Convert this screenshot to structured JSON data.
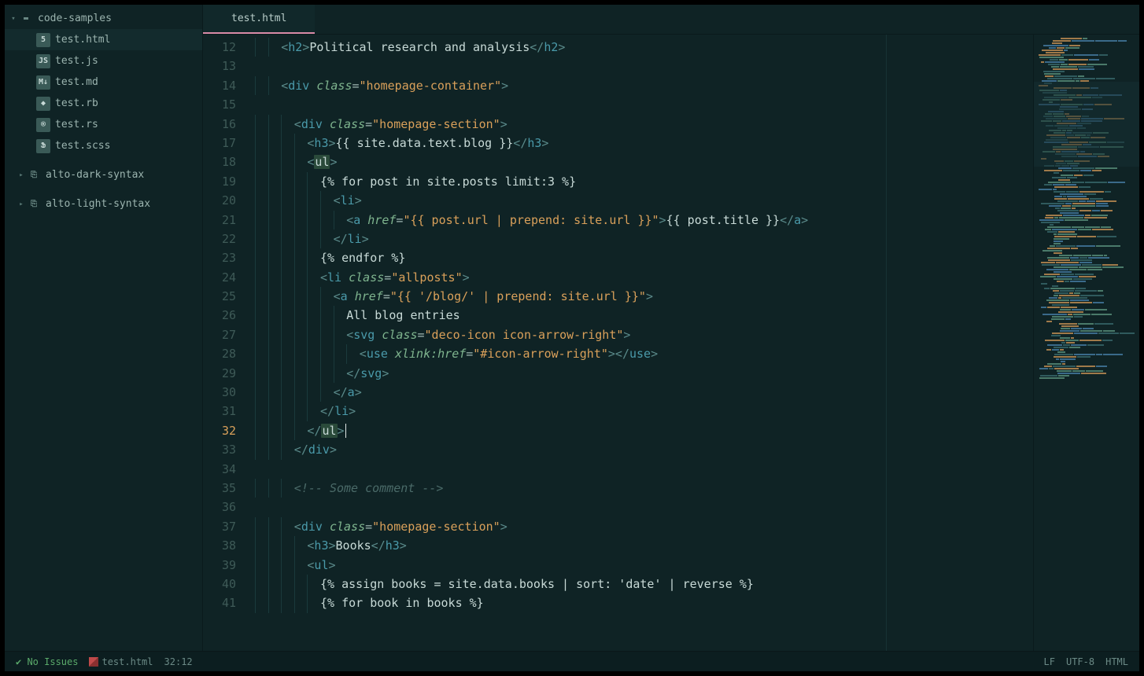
{
  "sidebar": {
    "root_folder": "code-samples",
    "files": [
      {
        "name": "test.html",
        "icon": "html",
        "selected": true,
        "icon_label": "5"
      },
      {
        "name": "test.js",
        "icon": "js",
        "icon_label": "JS"
      },
      {
        "name": "test.md",
        "icon": "md",
        "icon_label": "M↓"
      },
      {
        "name": "test.rb",
        "icon": "rb",
        "icon_label": "◆"
      },
      {
        "name": "test.rs",
        "icon": "rs",
        "icon_label": "®"
      },
      {
        "name": "test.scss",
        "icon": "scss",
        "icon_label": "Ֆ"
      }
    ],
    "projects": [
      {
        "name": "alto-dark-syntax"
      },
      {
        "name": "alto-light-syntax"
      }
    ]
  },
  "tabs": {
    "active": "test.html"
  },
  "editor": {
    "first_line_number": 12,
    "cursor_line": 32,
    "lines": [
      {
        "n": 12,
        "indent": 2,
        "tokens": [
          {
            "c": "p",
            "t": "<"
          },
          {
            "c": "tg",
            "t": "h2"
          },
          {
            "c": "p",
            "t": ">"
          },
          {
            "c": "tx",
            "t": "Political research and analysis"
          },
          {
            "c": "p",
            "t": "</"
          },
          {
            "c": "tg",
            "t": "h2"
          },
          {
            "c": "p",
            "t": ">"
          }
        ]
      },
      {
        "n": 13,
        "indent": 0,
        "tokens": []
      },
      {
        "n": 14,
        "indent": 2,
        "tokens": [
          {
            "c": "p",
            "t": "<"
          },
          {
            "c": "tg",
            "t": "div"
          },
          {
            "c": "tx",
            "t": " "
          },
          {
            "c": "an",
            "t": "class"
          },
          {
            "c": "op",
            "t": "="
          },
          {
            "c": "st",
            "t": "\"homepage-container\""
          },
          {
            "c": "p",
            "t": ">"
          }
        ]
      },
      {
        "n": 15,
        "indent": 0,
        "tokens": []
      },
      {
        "n": 16,
        "indent": 3,
        "tokens": [
          {
            "c": "p",
            "t": "<"
          },
          {
            "c": "tg",
            "t": "div"
          },
          {
            "c": "tx",
            "t": " "
          },
          {
            "c": "an",
            "t": "class"
          },
          {
            "c": "op",
            "t": "="
          },
          {
            "c": "st",
            "t": "\"homepage-section\""
          },
          {
            "c": "p",
            "t": ">"
          }
        ]
      },
      {
        "n": 17,
        "indent": 4,
        "tokens": [
          {
            "c": "p",
            "t": "<"
          },
          {
            "c": "tg",
            "t": "h3"
          },
          {
            "c": "p",
            "t": ">"
          },
          {
            "c": "tx",
            "t": "{{ site.data.text.blog }}"
          },
          {
            "c": "p",
            "t": "</"
          },
          {
            "c": "tg",
            "t": "h3"
          },
          {
            "c": "p",
            "t": ">"
          }
        ]
      },
      {
        "n": 18,
        "indent": 4,
        "tokens": [
          {
            "c": "p",
            "t": "<"
          },
          {
            "c": "hl",
            "t": "ul"
          },
          {
            "c": "p",
            "t": ">"
          }
        ]
      },
      {
        "n": 19,
        "indent": 5,
        "tokens": [
          {
            "c": "tx",
            "t": "{% for post in site.posts limit:3 %}"
          }
        ]
      },
      {
        "n": 20,
        "indent": 6,
        "tokens": [
          {
            "c": "p",
            "t": "<"
          },
          {
            "c": "tg",
            "t": "li"
          },
          {
            "c": "p",
            "t": ">"
          }
        ]
      },
      {
        "n": 21,
        "indent": 7,
        "tokens": [
          {
            "c": "p",
            "t": "<"
          },
          {
            "c": "tg",
            "t": "a"
          },
          {
            "c": "tx",
            "t": " "
          },
          {
            "c": "an",
            "t": "href"
          },
          {
            "c": "op",
            "t": "="
          },
          {
            "c": "st",
            "t": "\"{{ post.url | prepend: site.url }}\""
          },
          {
            "c": "p",
            "t": ">"
          },
          {
            "c": "tx",
            "t": "{{ post.title }}"
          },
          {
            "c": "p",
            "t": "</"
          },
          {
            "c": "tg",
            "t": "a"
          },
          {
            "c": "p",
            "t": ">"
          }
        ]
      },
      {
        "n": 22,
        "indent": 6,
        "tokens": [
          {
            "c": "p",
            "t": "</"
          },
          {
            "c": "tg",
            "t": "li"
          },
          {
            "c": "p",
            "t": ">"
          }
        ]
      },
      {
        "n": 23,
        "indent": 5,
        "tokens": [
          {
            "c": "tx",
            "t": "{% endfor %}"
          }
        ]
      },
      {
        "n": 24,
        "indent": 5,
        "tokens": [
          {
            "c": "p",
            "t": "<"
          },
          {
            "c": "tg",
            "t": "li"
          },
          {
            "c": "tx",
            "t": " "
          },
          {
            "c": "an",
            "t": "class"
          },
          {
            "c": "op",
            "t": "="
          },
          {
            "c": "st",
            "t": "\"allposts\""
          },
          {
            "c": "p",
            "t": ">"
          }
        ]
      },
      {
        "n": 25,
        "indent": 6,
        "tokens": [
          {
            "c": "p",
            "t": "<"
          },
          {
            "c": "tg",
            "t": "a"
          },
          {
            "c": "tx",
            "t": " "
          },
          {
            "c": "an",
            "t": "href"
          },
          {
            "c": "op",
            "t": "="
          },
          {
            "c": "st",
            "t": "\"{{ '/blog/' | prepend: site.url }}\""
          },
          {
            "c": "p",
            "t": ">"
          }
        ]
      },
      {
        "n": 26,
        "indent": 7,
        "tokens": [
          {
            "c": "tx",
            "t": "All blog entries"
          }
        ]
      },
      {
        "n": 27,
        "indent": 7,
        "tokens": [
          {
            "c": "p",
            "t": "<"
          },
          {
            "c": "tg",
            "t": "svg"
          },
          {
            "c": "tx",
            "t": " "
          },
          {
            "c": "an",
            "t": "class"
          },
          {
            "c": "op",
            "t": "="
          },
          {
            "c": "st",
            "t": "\"deco-icon icon-arrow-right\""
          },
          {
            "c": "p",
            "t": ">"
          }
        ]
      },
      {
        "n": 28,
        "indent": 8,
        "tokens": [
          {
            "c": "p",
            "t": "<"
          },
          {
            "c": "tg",
            "t": "use"
          },
          {
            "c": "tx",
            "t": " "
          },
          {
            "c": "an",
            "t": "xlink:href"
          },
          {
            "c": "op",
            "t": "="
          },
          {
            "c": "st",
            "t": "\"#icon-arrow-right\""
          },
          {
            "c": "p",
            "t": ">"
          },
          {
            "c": "p",
            "t": "</"
          },
          {
            "c": "tg",
            "t": "use"
          },
          {
            "c": "p",
            "t": ">"
          }
        ]
      },
      {
        "n": 29,
        "indent": 7,
        "tokens": [
          {
            "c": "p",
            "t": "</"
          },
          {
            "c": "tg",
            "t": "svg"
          },
          {
            "c": "p",
            "t": ">"
          }
        ]
      },
      {
        "n": 30,
        "indent": 6,
        "tokens": [
          {
            "c": "p",
            "t": "</"
          },
          {
            "c": "tg",
            "t": "a"
          },
          {
            "c": "p",
            "t": ">"
          }
        ]
      },
      {
        "n": 31,
        "indent": 5,
        "tokens": [
          {
            "c": "p",
            "t": "</"
          },
          {
            "c": "tg",
            "t": "li"
          },
          {
            "c": "p",
            "t": ">"
          }
        ]
      },
      {
        "n": 32,
        "indent": 4,
        "tokens": [
          {
            "c": "p",
            "t": "</"
          },
          {
            "c": "hl",
            "t": "ul"
          },
          {
            "c": "p",
            "t": ">"
          }
        ],
        "cursor": true
      },
      {
        "n": 33,
        "indent": 3,
        "tokens": [
          {
            "c": "p",
            "t": "</"
          },
          {
            "c": "tg",
            "t": "div"
          },
          {
            "c": "p",
            "t": ">"
          }
        ]
      },
      {
        "n": 34,
        "indent": 0,
        "tokens": []
      },
      {
        "n": 35,
        "indent": 3,
        "tokens": [
          {
            "c": "cm",
            "t": "<!-- Some comment -->"
          }
        ]
      },
      {
        "n": 36,
        "indent": 0,
        "tokens": []
      },
      {
        "n": 37,
        "indent": 3,
        "tokens": [
          {
            "c": "p",
            "t": "<"
          },
          {
            "c": "tg",
            "t": "div"
          },
          {
            "c": "tx",
            "t": " "
          },
          {
            "c": "an",
            "t": "class"
          },
          {
            "c": "op",
            "t": "="
          },
          {
            "c": "st",
            "t": "\"homepage-section\""
          },
          {
            "c": "p",
            "t": ">"
          }
        ]
      },
      {
        "n": 38,
        "indent": 4,
        "tokens": [
          {
            "c": "p",
            "t": "<"
          },
          {
            "c": "tg",
            "t": "h3"
          },
          {
            "c": "p",
            "t": ">"
          },
          {
            "c": "tx",
            "t": "Books"
          },
          {
            "c": "p",
            "t": "</"
          },
          {
            "c": "tg",
            "t": "h3"
          },
          {
            "c": "p",
            "t": ">"
          }
        ]
      },
      {
        "n": 39,
        "indent": 4,
        "tokens": [
          {
            "c": "p",
            "t": "<"
          },
          {
            "c": "tg",
            "t": "ul"
          },
          {
            "c": "p",
            "t": ">"
          }
        ]
      },
      {
        "n": 40,
        "indent": 5,
        "tokens": [
          {
            "c": "tx",
            "t": "{% assign books = site.data.books | sort: 'date' | reverse %}"
          }
        ]
      },
      {
        "n": 41,
        "indent": 5,
        "tokens": [
          {
            "c": "tx",
            "t": "{% for book in books %}"
          }
        ]
      }
    ]
  },
  "status": {
    "issues": "No Issues",
    "path": "test.html",
    "cursor": "32:12",
    "eol": "LF",
    "encoding": "UTF-8",
    "language": "HTML"
  }
}
